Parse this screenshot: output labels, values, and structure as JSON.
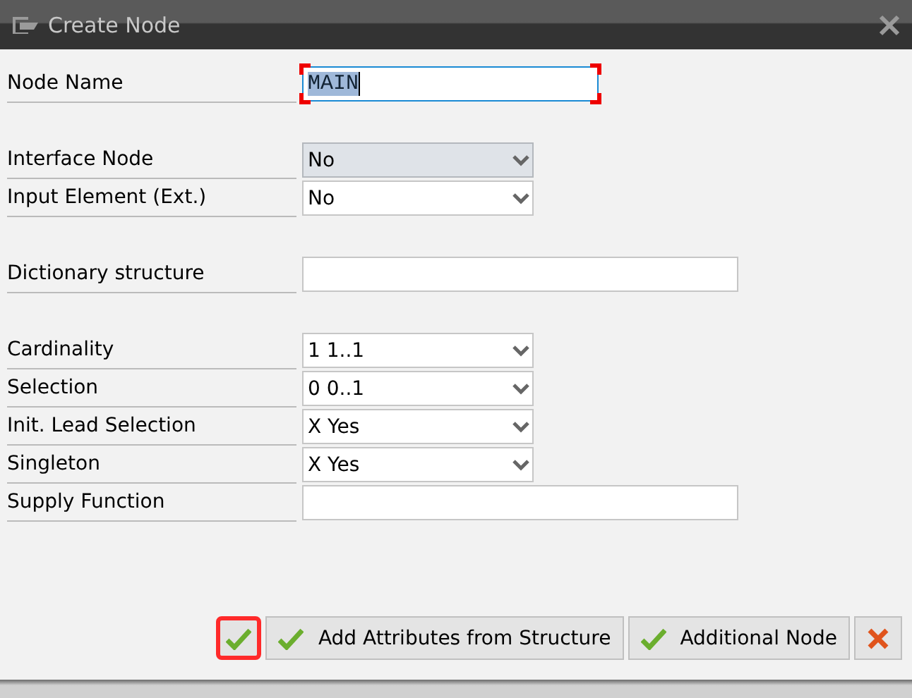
{
  "window": {
    "title": "Create Node"
  },
  "groups": [
    {
      "rows": [
        {
          "label": "Node Name",
          "kind": "name",
          "value": "MAIN",
          "focused": true
        }
      ]
    },
    {
      "rows": [
        {
          "label": "Interface Node",
          "kind": "dropdown",
          "value": "No",
          "disabled": true
        },
        {
          "label": "Input Element (Ext.)",
          "kind": "dropdown",
          "value": "No",
          "disabled": false
        }
      ]
    },
    {
      "rows": [
        {
          "label": "Dictionary structure",
          "kind": "text"
        }
      ]
    },
    {
      "rows": [
        {
          "label": "Cardinality",
          "kind": "dropdown",
          "value": "1 1..1",
          "disabled": false
        },
        {
          "label": "Selection",
          "kind": "dropdown",
          "value": "0 0..1",
          "disabled": false
        },
        {
          "label": "Init. Lead Selection",
          "kind": "dropdown",
          "value": "X Yes",
          "disabled": false
        },
        {
          "label": "Singleton",
          "kind": "dropdown",
          "value": "X Yes",
          "disabled": false
        },
        {
          "label": "Supply Function",
          "kind": "text"
        }
      ]
    }
  ],
  "buttons": [
    {
      "kind": "check",
      "focused": true
    },
    {
      "kind": "check",
      "label": "Add Attributes from Structure",
      "focused": false
    },
    {
      "kind": "check",
      "label": "Additional Node",
      "focused": false
    },
    {
      "kind": "cancel",
      "focused": false
    }
  ]
}
